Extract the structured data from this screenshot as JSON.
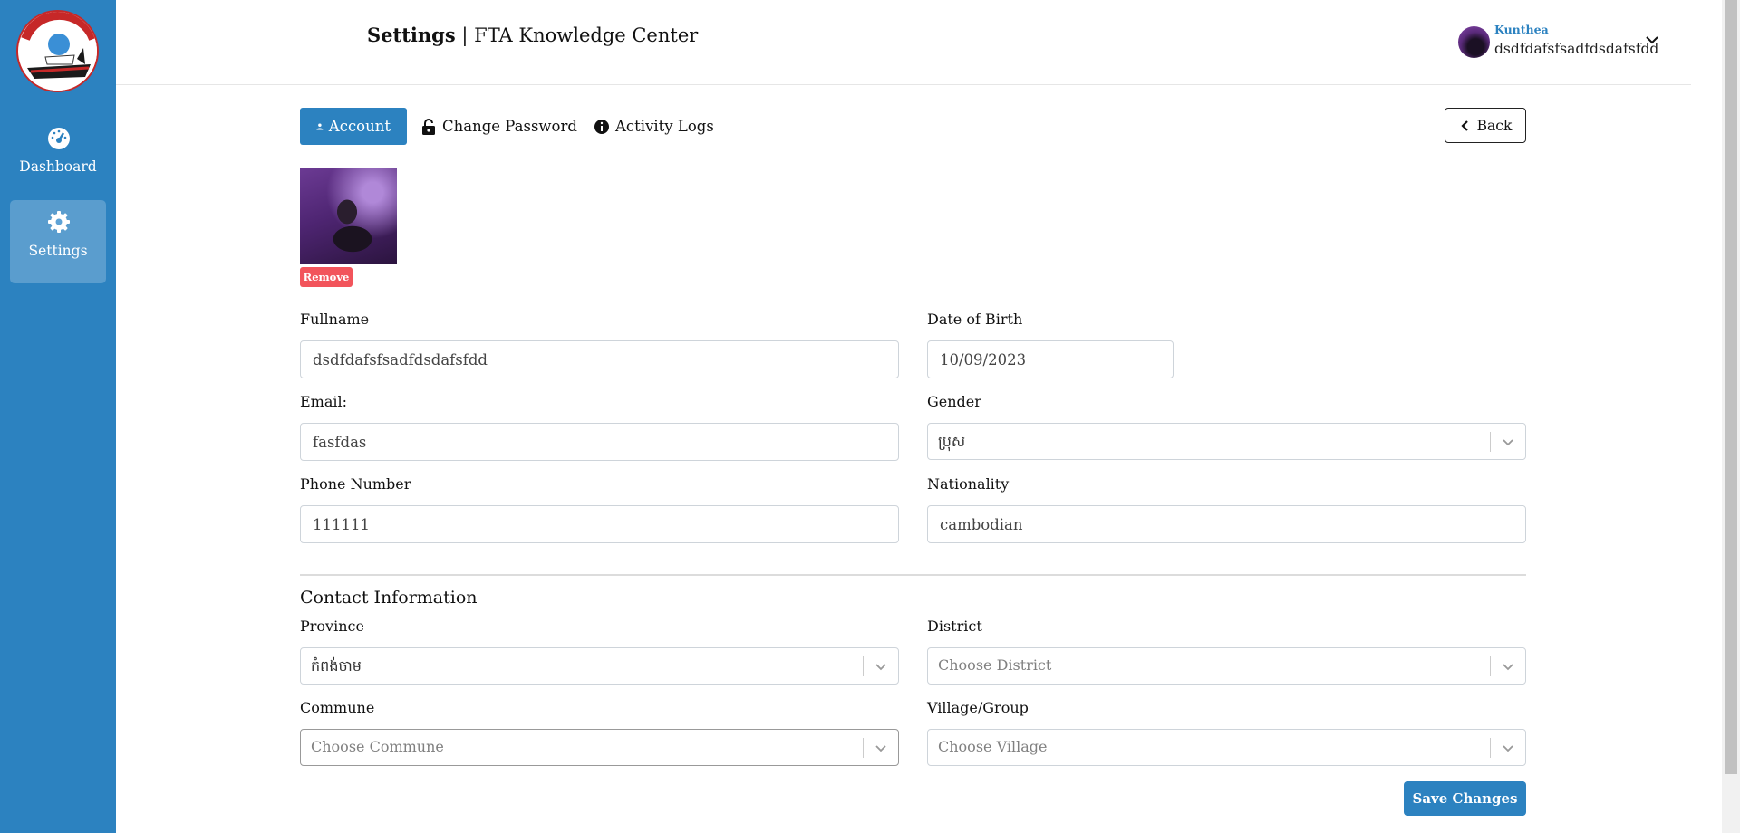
{
  "sidebar": {
    "items": [
      {
        "label": "Dashboard",
        "icon": "gauge-icon"
      },
      {
        "label": "Settings",
        "icon": "gear-icon",
        "active": true
      }
    ]
  },
  "header": {
    "title_strong": "Settings",
    "title_rest": "| FTA Knowledge Center",
    "user": {
      "name": "Kunthea",
      "fullname": "dsdfdafsfsadfdsdafsfdd"
    }
  },
  "tabs": [
    {
      "label": "Account",
      "icon": "user-icon",
      "active": true
    },
    {
      "label": "Change Password",
      "icon": "lock-icon"
    },
    {
      "label": "Activity Logs",
      "icon": "info-icon"
    }
  ],
  "back_label": "Back",
  "photo": {
    "remove_label": "Remove"
  },
  "form": {
    "fullname": {
      "label": "Fullname",
      "value": "dsdfdafsfsadfdsdafsfdd"
    },
    "dob": {
      "label": "Date of Birth",
      "value": "10/09/2023"
    },
    "email": {
      "label": "Email:",
      "value": "fasfdas"
    },
    "gender": {
      "label": "Gender",
      "value": "ប្រុស"
    },
    "phone": {
      "label": "Phone Number",
      "value": "111111"
    },
    "nationality": {
      "label": "Nationality",
      "value": "cambodian"
    }
  },
  "contact": {
    "title": "Contact Information",
    "province": {
      "label": "Province",
      "value": "កំពង់ចាម"
    },
    "district": {
      "label": "District",
      "placeholder": "Choose District"
    },
    "commune": {
      "label": "Commune",
      "placeholder": "Choose Commune"
    },
    "village": {
      "label": "Village/Group",
      "placeholder": "Choose Village"
    }
  },
  "save_label": "Save Changes",
  "colors": {
    "primary": "#2c82c0",
    "danger": "#f2545b",
    "sidebar": "#2c82c0"
  }
}
